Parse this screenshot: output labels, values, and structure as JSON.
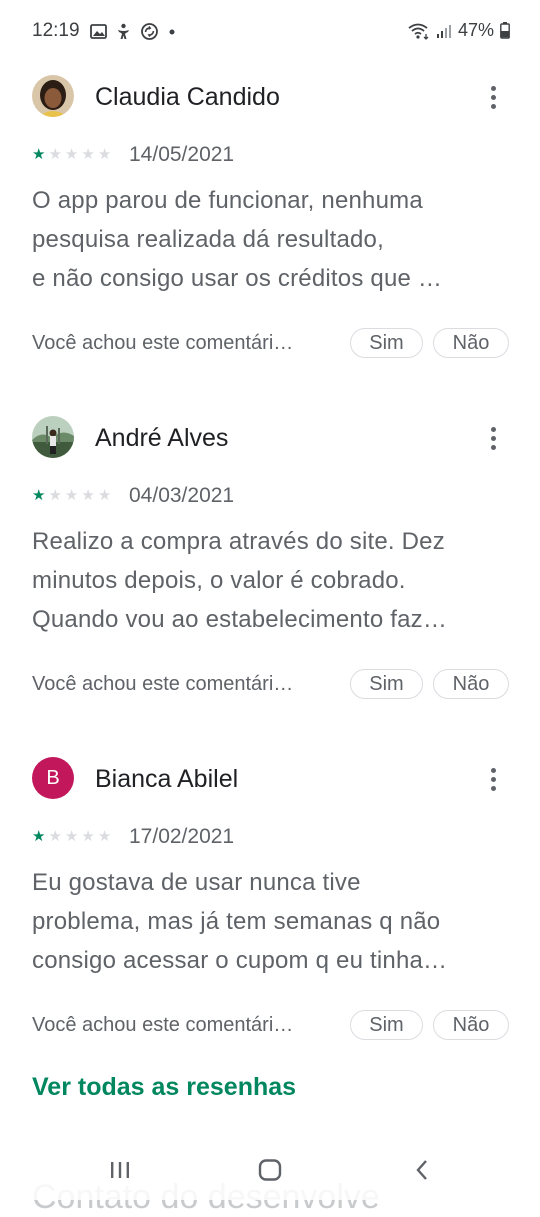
{
  "status_bar": {
    "time": "12:19",
    "battery": "47%",
    "icons": [
      "gallery-icon",
      "accessibility-icon",
      "sync-icon",
      "dot-icon"
    ]
  },
  "reviews": [
    {
      "name": "Claudia Candido",
      "avatar_type": "photo",
      "rating": 1,
      "date": "14/05/2021",
      "text": "O app parou de funcionar, nenhuma pesquisa realizada dá resultado, e não consigo usar os créditos que …",
      "lines": [
        "O app parou de funcionar, nenhuma",
        "pesquisa realizada dá resultado,",
        "e não consigo usar os créditos que …"
      ],
      "helpful_question": "Você achou este comentári…",
      "yes_label": "Sim",
      "no_label": "Não"
    },
    {
      "name": "André Alves",
      "avatar_type": "photo",
      "rating": 1,
      "date": "04/03/2021",
      "lines": [
        "Realizo a compra através do site. Dez",
        "minutos depois, o valor é cobrado.",
        "Quando vou ao estabelecimento faz…"
      ],
      "helpful_question": "Você achou este comentári…",
      "yes_label": "Sim",
      "no_label": "Não"
    },
    {
      "name": "Bianca Abilel",
      "avatar_type": "initial",
      "avatar_initial": "B",
      "avatar_color": "#c2185b",
      "rating": 1,
      "date": "17/02/2021",
      "lines": [
        "Eu gostava de usar nunca tive",
        "problema, mas já tem semanas q não",
        "consigo acessar o cupom q eu tinha…"
      ],
      "helpful_question": "Você achou este comentári…",
      "yes_label": "Sim",
      "no_label": "Não"
    }
  ],
  "see_all_label": "Ver todas as resenhas",
  "next_section_label": "Contato do desenvolve",
  "colors": {
    "accent": "#01875f",
    "star_filled": "#01875f",
    "star_empty": "#dadce0"
  },
  "navigation_bar": [
    "recent-apps-icon",
    "home-icon",
    "back-icon"
  ]
}
